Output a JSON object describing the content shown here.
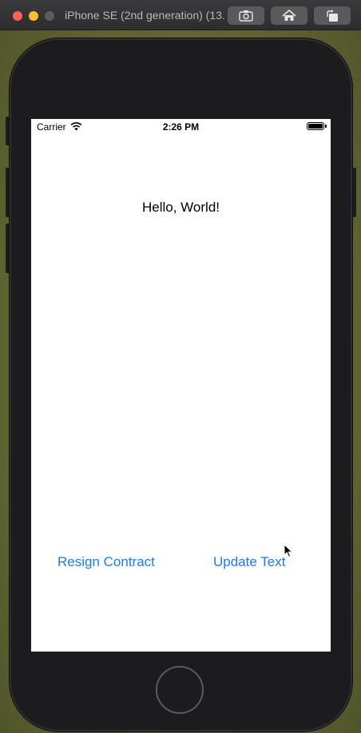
{
  "window": {
    "title": "iPhone SE (2nd generation) (13...",
    "toolbar": {
      "screenshot_icon": "camera-icon",
      "home_icon": "home-icon",
      "rotate_icon": "rotate-icon"
    }
  },
  "status_bar": {
    "carrier": "Carrier",
    "time": "2:26 PM",
    "wifi_icon": "wifi-icon",
    "battery_icon": "battery-icon",
    "battery_level": 1.0
  },
  "app": {
    "label": "Hello, World!",
    "buttons": {
      "resign": "Resign Contract",
      "update": "Update Text"
    },
    "tint_color": "#1a7cf4"
  },
  "colors": {
    "screen_background": "#ffffff",
    "device_body": "#1c1c1e",
    "desktop": "#6b6f36"
  }
}
